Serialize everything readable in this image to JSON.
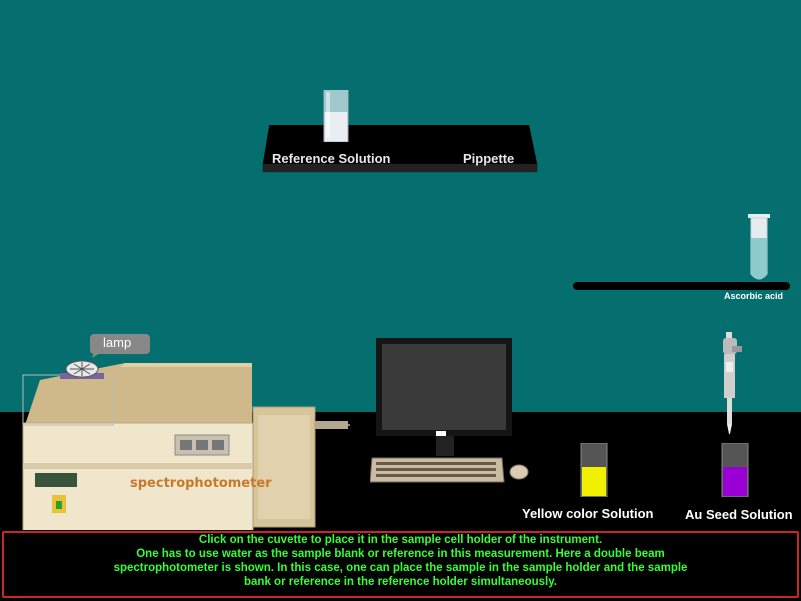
{
  "shelf": {
    "reference_label": "Reference Solution",
    "pipette_label": "Pippette"
  },
  "rack": {
    "ascorbic_label": "Ascorbic acid"
  },
  "solutions": {
    "yellow_label": "Yellow color Solution",
    "au_seed_label": "Au Seed Solution"
  },
  "instrument": {
    "lamp_label": "lamp",
    "name": "spectrophotometer"
  },
  "instructions": {
    "line1": "Click on the cuvette to place it in the sample cell holder of the instrument.",
    "line2": "One has to use water as the sample blank or reference in this measurement. Here a double beam",
    "line3": "spectrophotometer is shown. In this case, one can place the sample in the sample holder and the sample",
    "line4": "bank or reference in the reference holder simultaneously."
  },
  "colors": {
    "wall": "#056e6e",
    "floor": "#000000",
    "yellow_solution": "#f0f000",
    "au_solution": "#9a00d6",
    "instruction_text": "#33ff33",
    "instruction_border": "#c8262a"
  }
}
